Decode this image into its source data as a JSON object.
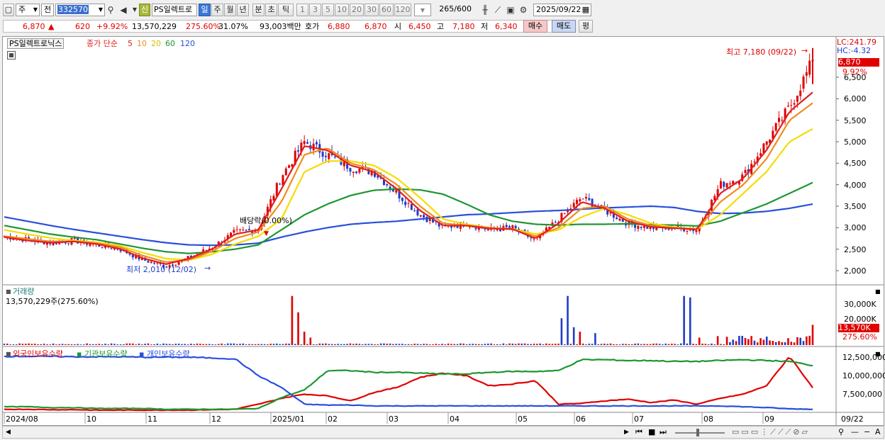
{
  "toolbar": {
    "type_label": "주",
    "type2_label": "전",
    "code": "332570",
    "name": "PS일렉트로",
    "badge": "신",
    "periods": [
      "일",
      "주",
      "월",
      "년",
      "분",
      "초",
      "틱"
    ],
    "active_period": "일",
    "nums": [
      "1",
      "3",
      "5",
      "10",
      "20",
      "30",
      "60",
      "120"
    ],
    "count": "265",
    "count_total": "/600",
    "date": "2025/09/22"
  },
  "quote": {
    "price": "6,870",
    "change": "620",
    "change_pct": "+9.92%",
    "volume": "13,570,229",
    "vol_pct": "275.60%",
    "turnover": "31.07%",
    "amount": "93,003백만",
    "ask_label": "호가",
    "ask": "6,880",
    "bid": "6,870",
    "open_label": "시",
    "open": "6,450",
    "high_label": "고",
    "high": "7,180",
    "low_label": "저",
    "low": "6,340",
    "buy_label": "매수",
    "sell_label": "매도",
    "extra_label": "평"
  },
  "legend": {
    "stock": "PS일렉트로닉스",
    "ma_label": "종가 단순",
    "ma": [
      {
        "label": "5",
        "color": "#e02020"
      },
      {
        "label": "10",
        "color": "#f08c1e"
      },
      {
        "label": "20",
        "color": "#f5dc00"
      },
      {
        "label": "60",
        "color": "#1e9632"
      },
      {
        "label": "120",
        "color": "#2850dc"
      }
    ]
  },
  "annot": {
    "high": "최고 7,180 (09/22)",
    "low": "최저 2,010 (12/02)",
    "dividend": "배당락(0.00%)",
    "lc": "LC:241.79",
    "hc": "HC:-4.32",
    "last_price": "6,870",
    "last_pct": "9.92%"
  },
  "volume_panel": {
    "title": "거래량",
    "value": "13,570,229주(275.60%)",
    "last": "13,570K",
    "last_pct": "275.60%",
    "ticks": [
      "30,000K",
      "20,000K",
      "10,000K"
    ]
  },
  "holding_panel": {
    "titles": [
      "외국인보유수량",
      "기관보유수량",
      "개인보유수량"
    ],
    "ticks": [
      "12,500,000",
      "10,000,000",
      "7,500,000"
    ]
  },
  "colors": {
    "up": "#e00000",
    "down": "#1e3cc8",
    "price_tag": "#e00000"
  },
  "chart_data": {
    "type": "line",
    "price_ticks": [
      6500,
      6000,
      5500,
      5000,
      4500,
      4000,
      3500,
      3000,
      2500,
      2000
    ],
    "price_tick_labels": [
      "6,500",
      "6,000",
      "5,500",
      "5,000",
      "4,500",
      "4,000",
      "3,500",
      "3,000",
      "2,500",
      "2,000"
    ],
    "x_labels": [
      "2024/08",
      "10",
      "11",
      "12",
      "2025/01",
      "02",
      "03",
      "04",
      "05",
      "06",
      "07",
      "08",
      "09",
      "09/22"
    ],
    "close_keypoints": [
      2800,
      2720,
      2650,
      2700,
      2600,
      2500,
      2250,
      2100,
      2300,
      2550,
      2900,
      2950,
      4200,
      5000,
      4700,
      4400,
      4300,
      3800,
      3300,
      3000,
      3100,
      2950,
      3000,
      2700,
      3200,
      3700,
      3400,
      3100,
      3000,
      3000,
      2950,
      4000,
      4200,
      5000,
      5800,
      6870
    ],
    "ma_points": {
      "ma5": [
        2780,
        2700,
        2650,
        2680,
        2620,
        2510,
        2290,
        2150,
        2280,
        2500,
        2850,
        2950,
        3900,
        4900,
        4800,
        4450,
        4300,
        3900,
        3400,
        3050,
        3050,
        2980,
        2970,
        2750,
        3100,
        3600,
        3450,
        3150,
        3020,
        2990,
        2960,
        3800,
        4150,
        4800,
        5700,
        6150
      ],
      "ma10": [
        2800,
        2740,
        2680,
        2680,
        2640,
        2550,
        2350,
        2200,
        2250,
        2450,
        2750,
        2900,
        3600,
        4700,
        4850,
        4500,
        4350,
        4000,
        3500,
        3100,
        3050,
        3000,
        2960,
        2800,
        3000,
        3450,
        3500,
        3200,
        3050,
        2990,
        2960,
        3600,
        4000,
        4600,
        5500,
        5900
      ],
      "ma20": [
        2950,
        2850,
        2760,
        2700,
        2660,
        2580,
        2420,
        2280,
        2250,
        2380,
        2620,
        2800,
        3200,
        4300,
        4550,
        4550,
        4450,
        4150,
        3700,
        3200,
        3080,
        3000,
        2970,
        2850,
        2950,
        3250,
        3450,
        3300,
        3100,
        3010,
        2970,
        3300,
        3800,
        4300,
        5000,
        5300
      ],
      "ma60": [
        3050,
        2950,
        2850,
        2780,
        2720,
        2620,
        2520,
        2440,
        2400,
        2440,
        2500,
        2600,
        2950,
        3300,
        3550,
        3750,
        3870,
        3900,
        3880,
        3780,
        3550,
        3300,
        3150,
        3080,
        3060,
        3080,
        3080,
        3090,
        3070,
        3060,
        3040,
        3150,
        3350,
        3550,
        3800,
        4050
      ],
      "ma120": [
        3250,
        3150,
        3050,
        2960,
        2880,
        2800,
        2720,
        2650,
        2600,
        2590,
        2600,
        2640,
        2780,
        2900,
        3000,
        3080,
        3120,
        3150,
        3200,
        3250,
        3300,
        3320,
        3350,
        3380,
        3400,
        3430,
        3460,
        3480,
        3500,
        3470,
        3380,
        3330,
        3340,
        3380,
        3450,
        3550
      ]
    },
    "holding_series": [
      {
        "name": "외국인보유수량",
        "color": "#e00000",
        "values": [
          6200,
          6200,
          6150,
          6150,
          6100,
          6100,
          6100,
          6100,
          6100,
          6150,
          6200,
          6800,
          7500,
          8000,
          7800,
          7200,
          8200,
          8800,
          10000,
          10500,
          10200,
          9000,
          9200,
          9600,
          6800,
          6900,
          7200,
          7400,
          7000,
          7300,
          6800,
          7500,
          8000,
          9000,
          12500,
          8800
        ]
      },
      {
        "name": "기관보유수량",
        "color": "#1e9632",
        "values": [
          6500,
          6500,
          6400,
          6400,
          6300,
          6300,
          6300,
          6200,
          6200,
          6200,
          6200,
          6300,
          7600,
          8500,
          10800,
          10800,
          10600,
          10600,
          10500,
          10400,
          10400,
          10600,
          10700,
          10700,
          10800,
          12100,
          12100,
          12000,
          12000,
          11900,
          11900,
          12000,
          12100,
          12000,
          11900,
          11400
        ]
      },
      {
        "name": "개인보유수량",
        "color": "#2850dc",
        "values": [
          12500,
          12500,
          12500,
          12450,
          12450,
          12450,
          12400,
          12400,
          12400,
          12300,
          12200,
          10200,
          8800,
          6800,
          6700,
          6700,
          6600,
          6600,
          6600,
          6600,
          6600,
          6600,
          6600,
          6600,
          6600,
          6600,
          6600,
          6600,
          6600,
          6600,
          6600,
          6600,
          6500,
          6400,
          6250,
          6200
        ]
      }
    ],
    "holding_range": [
      6000,
      13000
    ]
  }
}
